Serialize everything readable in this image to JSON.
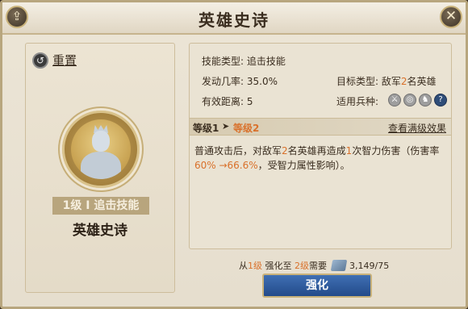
{
  "window": {
    "title": "英雄史诗"
  },
  "left": {
    "reset_label": "重置",
    "level_label": "1级 I 追击技能",
    "skill_name": "英雄史诗"
  },
  "info": {
    "skill_type": "技能类型: 追击技能",
    "trigger_rate": "发动几率: 35.0%",
    "effective_range": "有效距离: 5",
    "target_type_prefix": "目标类型: 敌军",
    "target_type_count": "2",
    "target_type_suffix": "名英雄",
    "unit_types_label": "适用兵种:",
    "unit_icons": [
      "sword-icon",
      "bow-icon",
      "horse-icon",
      "help-icon"
    ]
  },
  "levels": {
    "current": "等级1",
    "arrow": "➤",
    "next": "等级2",
    "view_max": "查看满级效果"
  },
  "description": {
    "part1": "普通攻击后，对敌军",
    "count": "2",
    "part2": "名英雄再造成",
    "times": "1",
    "part3": "次智力伤害（伤害率",
    "rate": "60% →66.6%",
    "part4": "，受智力属性影响）。"
  },
  "upgrade": {
    "from_prefix": "从",
    "from_level": "1级",
    "mid": " 强化至 ",
    "to_level": "2级",
    "need": "需要",
    "cost": "3,149/75",
    "button_label": "强化"
  },
  "colors": {
    "accent": "#d9712b",
    "button": "#2f5c9f",
    "frame": "#c9b27a"
  }
}
